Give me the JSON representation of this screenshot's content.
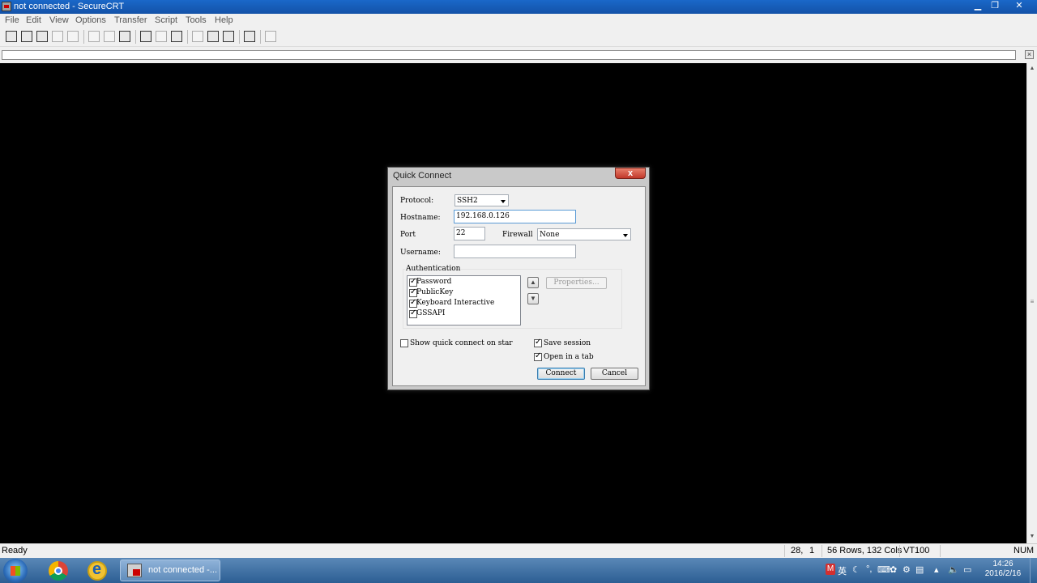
{
  "window": {
    "title": "not connected - SecureCRT"
  },
  "menu": [
    "File",
    "Edit",
    "View",
    "Options",
    "Transfer",
    "Script",
    "Tools",
    "Help"
  ],
  "toolbar_icons": [
    "connect-icon",
    "quick-connect-icon",
    "connect-in-tab-icon",
    "reconnect-icon",
    "disconnect-icon",
    "copy-icon",
    "paste-icon",
    "find-icon",
    "print-icon",
    "print-selection-icon",
    "print-setup-icon",
    "session-options-icon",
    "global-options-icon",
    "keymap-icon",
    "help-icon",
    "script-icon"
  ],
  "command_bar": {
    "value": ""
  },
  "dialog": {
    "title": "Quick Connect",
    "close_label": "x",
    "protocol_label": "Protocol:",
    "protocol_value": "SSH2",
    "hostname_label": "Hostname:",
    "hostname_value": "192.168.0.126",
    "port_label": "Port",
    "port_value": "22",
    "firewall_label": "Firewall",
    "firewall_value": "None",
    "username_label": "Username:",
    "username_value": "",
    "auth_group_label": "Authentication",
    "auth_methods": [
      {
        "label": "Password",
        "checked": true
      },
      {
        "label": "PublicKey",
        "checked": true
      },
      {
        "label": "Keyboard Interactive",
        "checked": true
      },
      {
        "label": "GSSAPI",
        "checked": true
      }
    ],
    "properties_label": "Properties...",
    "show_quick_connect_label": "Show quick connect on star",
    "show_quick_connect_checked": false,
    "save_session_label": "Save session",
    "save_session_checked": true,
    "open_in_tab_label": "Open in a tab",
    "open_in_tab_checked": true,
    "connect_label": "Connect",
    "cancel_label": "Cancel"
  },
  "status": {
    "text": "Ready",
    "cursor_row": "28,",
    "cursor_col": "1",
    "dims": "56 Rows, 132 Cols",
    "terminal": "VT100",
    "num": "NUM"
  },
  "taskbar": {
    "active_item": "not connected -...",
    "tray_ime": "英",
    "time": "14:26",
    "date": "2016/2/16"
  }
}
